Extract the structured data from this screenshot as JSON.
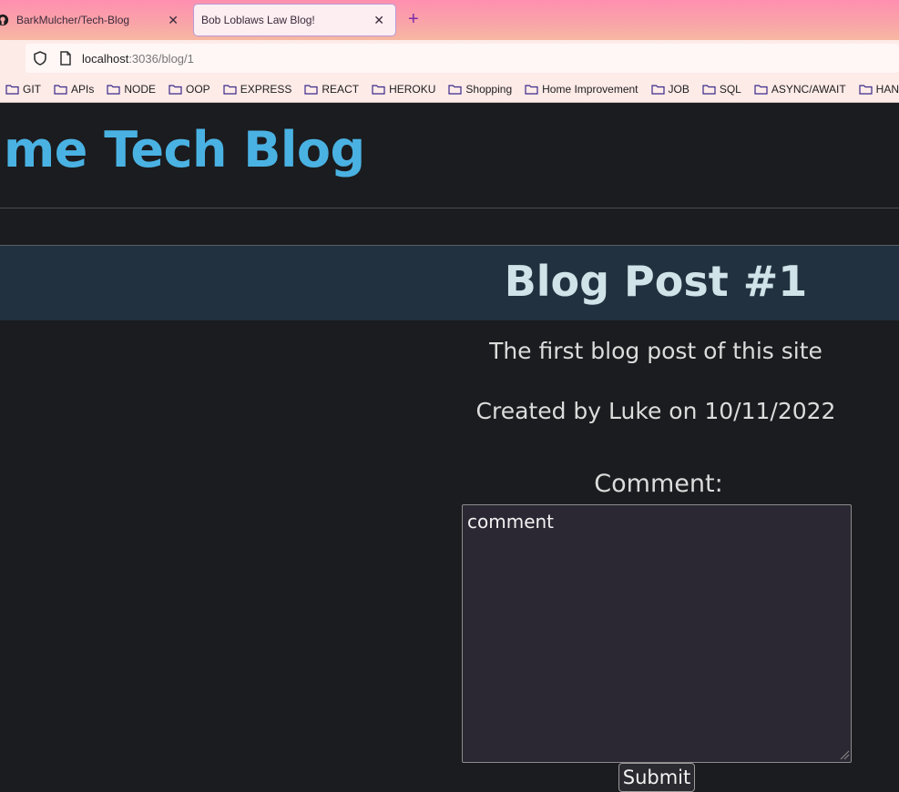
{
  "browser": {
    "tabs": [
      {
        "label": "BarkMulcher/Tech-Blog",
        "active": false
      },
      {
        "label": "Bob Loblaws Law Blog!",
        "active": true
      }
    ],
    "new_tab_label": "+",
    "close_glyph": "✕",
    "url": {
      "host": "localhost",
      "path": ":3036/blog/1"
    },
    "bookmarks": [
      "GIT",
      "APIs",
      "NODE",
      "OOP",
      "EXPRESS",
      "REACT",
      "HEROKU",
      "Shopping",
      "Home Improvement",
      "JOB",
      "SQL",
      "ASYNC/AWAIT",
      "HANDLEBARS"
    ],
    "icons": {
      "tab1": "github-icon",
      "security": "shield-icon",
      "page": "page-icon",
      "bookmark": "folder-icon"
    },
    "colors": {
      "tabbar_gradient_top": "#ff8fb0",
      "active_tab_outline": "#b99ad6",
      "new_tab": "#7a2ba8"
    }
  },
  "site": {
    "title": "ime Tech Blog",
    "colors": {
      "title": "#4ab2e3",
      "background": "#1b1c1f",
      "post_header": "#22313f",
      "post_title": "#cfe3e8"
    }
  },
  "post": {
    "title": "Blog Post #1",
    "description": "The first blog post of this site",
    "meta": "Created by Luke on 10/11/2022"
  },
  "comment_form": {
    "label": "Comment:",
    "value": "comment",
    "submit_label": "Submit"
  }
}
